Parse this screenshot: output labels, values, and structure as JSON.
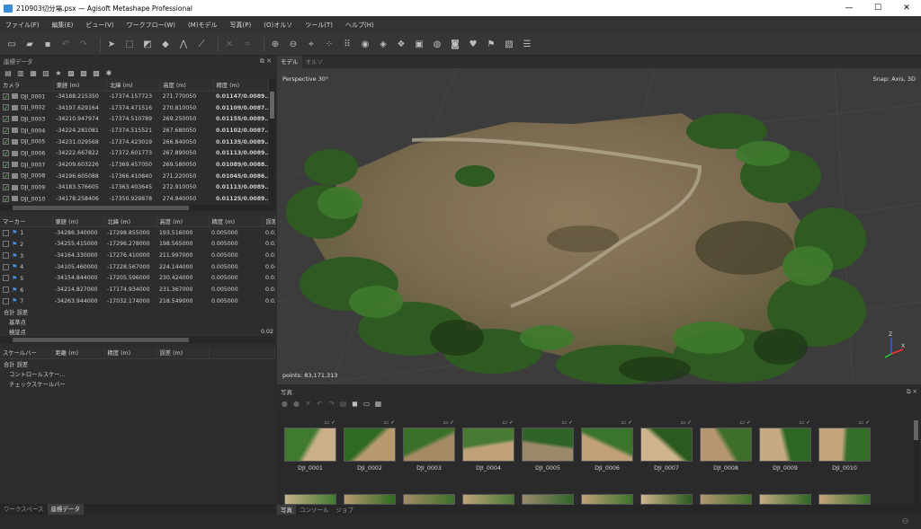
{
  "window": {
    "title": "210903切分場.psx — Agisoft Metashape Professional"
  },
  "menu": [
    "ファイル(F)",
    "編集(E)",
    "ビュー(V)",
    "ワークフロー(W)",
    "(M)モデル",
    "写真(P)",
    "(O)オルソ",
    "ツール(T)",
    "ヘルプ(H)"
  ],
  "reference_panel": {
    "title": "座標データ",
    "camera_headers": [
      "カメラ",
      "東経 (m)",
      "北緯 (m)",
      "高度 (m)",
      "精度 (m)",
      ""
    ],
    "cameras": [
      {
        "name": "DJI_0001",
        "east": "-34188.215350",
        "north": "-17374.157723",
        "alt": "271.770050",
        "acc": "0.01147/0.0089...",
        "extra": "C"
      },
      {
        "name": "DJI_0002",
        "east": "-34197.629164",
        "north": "-17374.471516",
        "alt": "270.810050",
        "acc": "0.01109/0.0087...",
        "extra": "C"
      },
      {
        "name": "DJI_0003",
        "east": "-34210.947974",
        "north": "-17374.510789",
        "alt": "269.250050",
        "acc": "0.01155/0.0089...",
        "extra": "C"
      },
      {
        "name": "DJI_0004",
        "east": "-34224.281081",
        "north": "-17374.515521",
        "alt": "267.680050",
        "acc": "0.01102/0.0087...",
        "extra": "C"
      },
      {
        "name": "DJI_0005",
        "east": "-34231.029568",
        "north": "-17374.423019",
        "alt": "266.840050",
        "acc": "0.01135/0.0089...",
        "extra": "C"
      },
      {
        "name": "DJI_0006",
        "east": "-34222.667822",
        "north": "-17372.601773",
        "alt": "267.890050",
        "acc": "0.01113/0.0089...",
        "extra": "C"
      },
      {
        "name": "DJI_0007",
        "east": "-34209.603226",
        "north": "-17369.457050",
        "alt": "269.580050",
        "acc": "0.01089/0.0088...",
        "extra": "C"
      },
      {
        "name": "DJI_0008",
        "east": "-34196.605088",
        "north": "-17366.410840",
        "alt": "271.220050",
        "acc": "0.01045/0.0086...",
        "extra": "C"
      },
      {
        "name": "DJI_0009",
        "east": "-34183.576605",
        "north": "-17363.403645",
        "alt": "272.910050",
        "acc": "0.01113/0.0089...",
        "extra": "C"
      },
      {
        "name": "DJI_0010",
        "east": "-34178.258406",
        "north": "-17350.929878",
        "alt": "274.940050",
        "acc": "0.01125/0.0089...",
        "extra": "C"
      }
    ],
    "marker_headers": [
      "マーカー",
      "東経 (m)",
      "北緯 (m)",
      "高度 (m)",
      "精度 (m)",
      "誤差"
    ],
    "markers": [
      {
        "name": "1",
        "east": "-34286.340000",
        "north": "-17298.855000",
        "alt": "193.516000",
        "acc": "0.005000",
        "err": "0.02"
      },
      {
        "name": "2",
        "east": "-34255.415000",
        "north": "-17296.278000",
        "alt": "198.565000",
        "acc": "0.005000",
        "err": "0.02"
      },
      {
        "name": "3",
        "east": "-34164.330000",
        "north": "-17276.410000",
        "alt": "211.997000",
        "acc": "0.005000",
        "err": "0.02"
      },
      {
        "name": "4",
        "east": "-34105.460000",
        "north": "-17228.567000",
        "alt": "224.144000",
        "acc": "0.005000",
        "err": "0.04"
      },
      {
        "name": "5",
        "east": "-34154.844000",
        "north": "-17205.596000",
        "alt": "230.424000",
        "acc": "0.005000",
        "err": "0.02"
      },
      {
        "name": "6",
        "east": "-34214.827000",
        "north": "-17174.934000",
        "alt": "231.367000",
        "acc": "0.005000",
        "err": "0.02"
      },
      {
        "name": "7",
        "east": "-34263.944000",
        "north": "-17032.174000",
        "alt": "218.549000",
        "acc": "0.005000",
        "err": "0.02"
      }
    ],
    "marker_summary": {
      "total": "合計 誤差",
      "control": "基準点",
      "check": "検証点",
      "check_err": "0.02"
    },
    "scalebar_headers": [
      "スケールバー",
      "距離 (m)",
      "精度 (m)",
      "誤差 (m)"
    ],
    "scalebar_summary": {
      "total": "合計 誤差",
      "control": "コントロールスケー...",
      "check": "チェックスケールバー"
    }
  },
  "left_tabs": [
    "ワークスペース",
    "座標データ"
  ],
  "model_tabs": [
    "モデル",
    "オルソ"
  ],
  "model_view": {
    "projection": "Perspective 30°",
    "snap": "Snap: Axis, 3D",
    "points": "points: 83,171,313"
  },
  "photos_panel": {
    "title": "写真",
    "thumbnails": [
      "DJI_0001",
      "DJI_0002",
      "DJI_0003",
      "DJI_0004",
      "DJI_0005",
      "DJI_0006",
      "DJI_0007",
      "DJI_0008",
      "DJI_0009",
      "DJI_0010"
    ],
    "tabs": [
      "写真",
      "コンソール",
      "ジョブ"
    ]
  },
  "colors": {
    "accent_check": "#4cd05c",
    "flag": "#4a8fe8",
    "background": "#2b2b2b"
  }
}
